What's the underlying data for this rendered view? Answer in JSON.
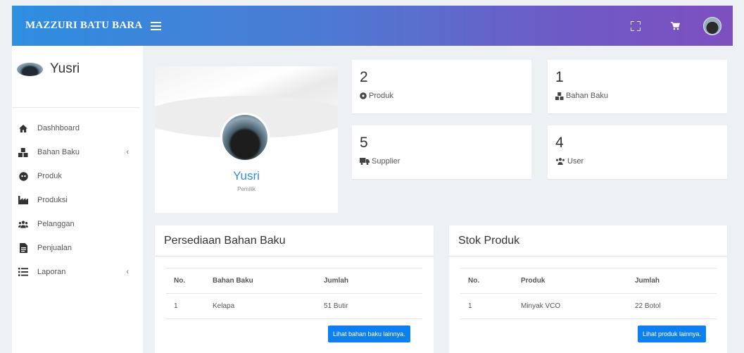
{
  "header": {
    "brand": "MAZZURI BATU BARA",
    "icons": [
      "menu-icon",
      "fullscreen-icon",
      "cart-icon",
      "user-avatar"
    ]
  },
  "sidebar": {
    "user_name": "Yusri",
    "items": [
      {
        "label": "Dashhboard",
        "icon": "home-icon",
        "has_chevron": false
      },
      {
        "label": "Bahan Baku",
        "icon": "boxes-icon",
        "has_chevron": true
      },
      {
        "label": "Produk",
        "icon": "cube-icon",
        "has_chevron": false
      },
      {
        "label": "Produksi",
        "icon": "factory-icon",
        "has_chevron": false
      },
      {
        "label": "Pelanggan",
        "icon": "users-icon",
        "has_chevron": false
      },
      {
        "label": "Penjualan",
        "icon": "receipt-icon",
        "has_chevron": false
      },
      {
        "label": "Laporan",
        "icon": "list-icon",
        "has_chevron": true
      }
    ],
    "chevron": "‹"
  },
  "profile": {
    "name": "Yusri",
    "role": "Pemilik"
  },
  "stats": [
    {
      "value": "2",
      "label": "Produk",
      "icon": "product-icon"
    },
    {
      "value": "1",
      "label": "Bahan Baku",
      "icon": "boxes-icon"
    },
    {
      "value": "5",
      "label": "Supplier",
      "icon": "truck-icon"
    },
    {
      "value": "4",
      "label": "User",
      "icon": "users-icon"
    }
  ],
  "bahan_baku_table": {
    "title": "Persediaan Bahan Baku",
    "columns": [
      "No.",
      "Bahan Baku",
      "Jumlah"
    ],
    "rows": [
      [
        "1",
        "Kelapa",
        "51 Butir"
      ]
    ],
    "button": "Lihat bahan baku lainnya."
  },
  "produk_table": {
    "title": "Stok Produk",
    "columns": [
      "No.",
      "Produk",
      "Jumlah"
    ],
    "rows": [
      [
        "1",
        "Minyak VCO",
        "22 Botol"
      ]
    ],
    "button": "Lihat produk lainnya."
  },
  "colors": {
    "header_start": "#2e8ee0",
    "header_end": "#7e4fc0",
    "accent": "#2f8dde",
    "button": "#0d7ff0"
  }
}
